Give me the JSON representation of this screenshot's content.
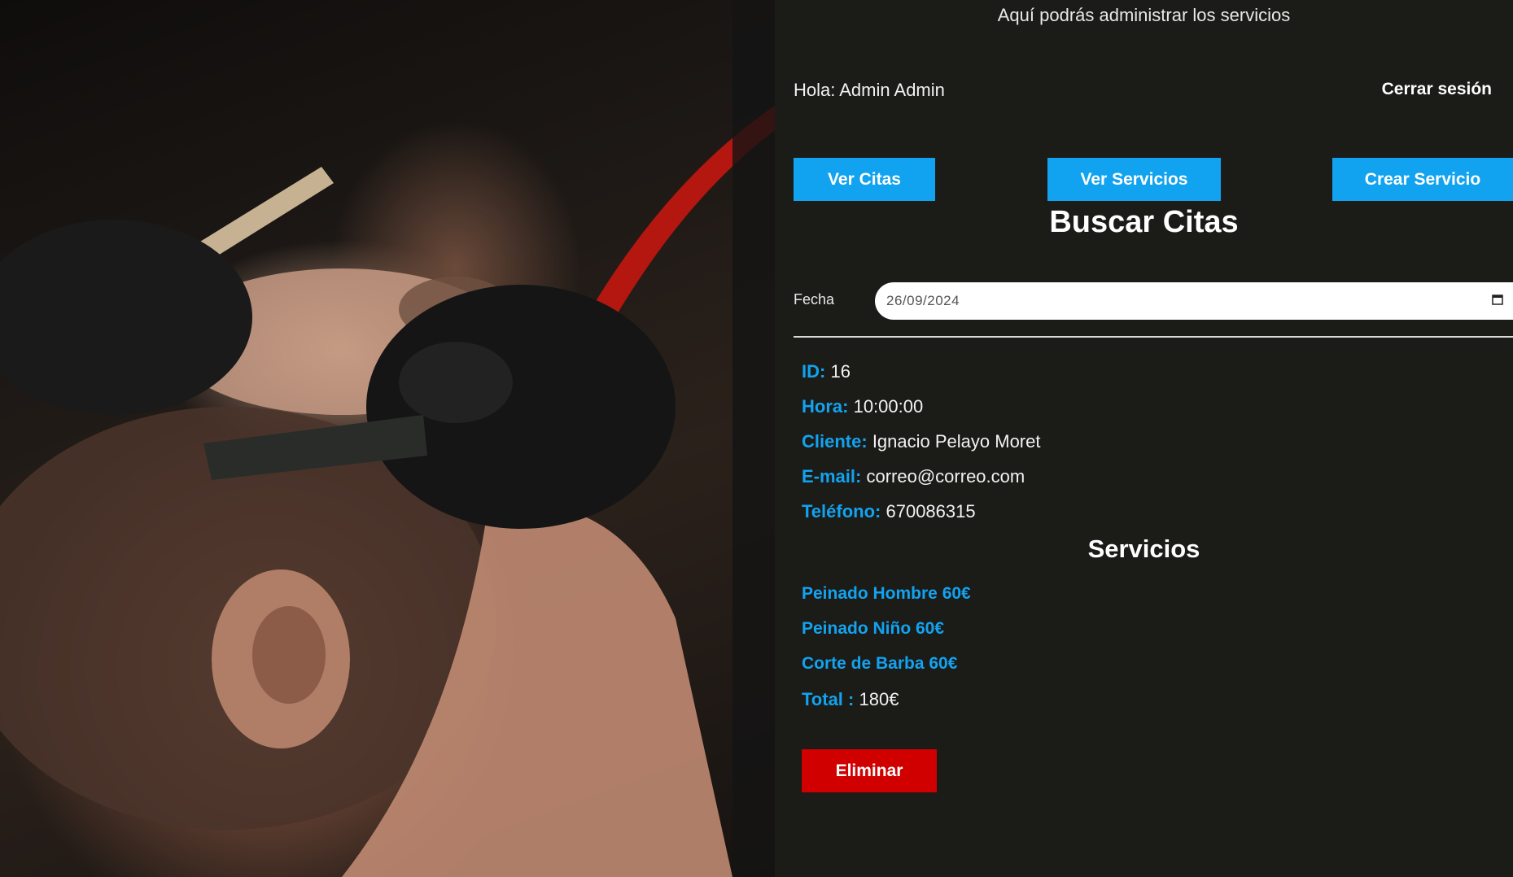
{
  "header": {
    "subtitle": "Aquí podrás administrar los servicios",
    "greeting": "Hola: Admin Admin",
    "logout_label": "Cerrar sesión"
  },
  "nav": {
    "ver_citas": "Ver Citas",
    "ver_servicios": "Ver Servicios",
    "crear_servicio": "Crear Servicio"
  },
  "search": {
    "title": "Buscar Citas",
    "date_label": "Fecha",
    "date_value": "26/09/2024"
  },
  "appointment": {
    "id_label": "ID:",
    "id_value": "16",
    "hora_label": "Hora:",
    "hora_value": "10:00:00",
    "cliente_label": "Cliente:",
    "cliente_value": "Ignacio Pelayo Moret",
    "email_label": "E-mail:",
    "email_value": "correo@correo.com",
    "telefono_label": "Teléfono:",
    "telefono_value": "670086315"
  },
  "services": {
    "title": "Servicios",
    "items": [
      "Peinado Hombre 60€",
      "Peinado Niño 60€",
      "Corte de Barba 60€"
    ],
    "total_label": "Total :",
    "total_value": "180€"
  },
  "actions": {
    "delete_label": "Eliminar"
  },
  "colors": {
    "background": "#1b1b18",
    "accent_blue": "#12a3f0",
    "danger_red": "#d00000"
  },
  "image": {
    "alt_icon": "barber-shaving-photo"
  }
}
